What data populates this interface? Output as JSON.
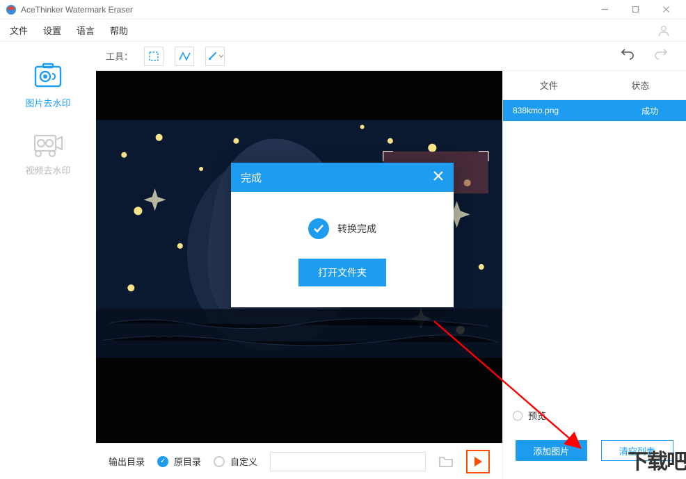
{
  "titlebar": {
    "app_name": "AceThinker Watermark Eraser"
  },
  "menu": {
    "file": "文件",
    "settings": "设置",
    "language": "语言",
    "help": "帮助"
  },
  "sidebar": {
    "image": "图片去水印",
    "video": "视频去水印"
  },
  "toolbar": {
    "label": "工具："
  },
  "panel": {
    "head_file": "文件",
    "head_status": "状态",
    "row_name": "838kmo.png",
    "row_status": "成功",
    "preview": "预览",
    "add_label": "添加图片",
    "clear_label": "清空列表"
  },
  "output": {
    "label": "输出目录",
    "opt_original": "原目录",
    "opt_custom": "自定义",
    "path": ""
  },
  "modal": {
    "title": "完成",
    "message": "转换完成",
    "open_button": "打开文件夹"
  },
  "brand": "下载吧"
}
